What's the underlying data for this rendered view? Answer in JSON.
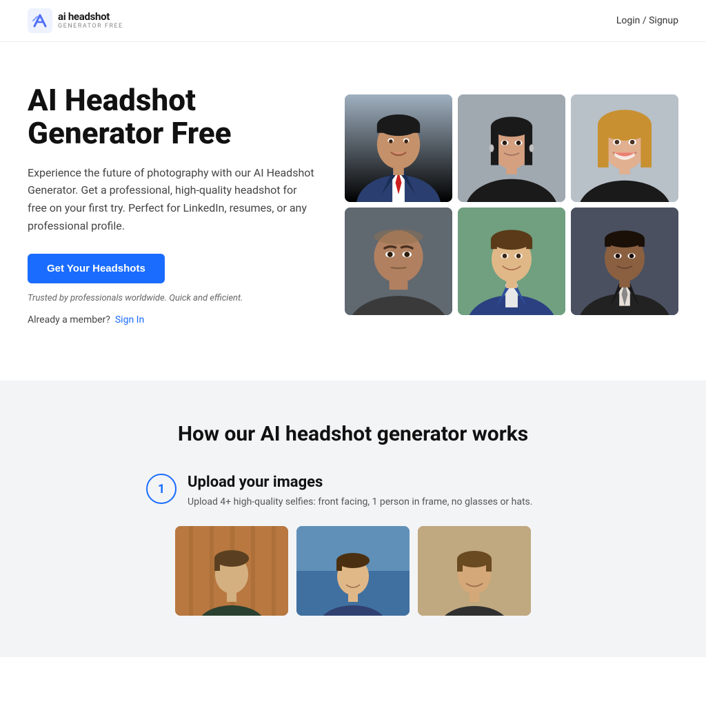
{
  "header": {
    "logo_main": "ai headshot",
    "logo_sub": "GENERATOR FREE",
    "nav_login": "Login / Signup"
  },
  "hero": {
    "title": "AI Headshot Generator Free",
    "description": "Experience the future of photography with our AI Headshot Generator. Get a professional, high-quality headshot for free on your first try. Perfect for LinkedIn, resumes, or any professional profile.",
    "cta_button": "Get Your Headshots",
    "trusted_text": "Trusted by professionals worldwide. Quick and efficient.",
    "member_text": "Already a member?",
    "sign_in_text": "Sign In"
  },
  "photo_grid": {
    "photos": [
      {
        "id": "photo-1",
        "alt": "Professional male headshot in suit"
      },
      {
        "id": "photo-2",
        "alt": "Professional female headshot"
      },
      {
        "id": "photo-3",
        "alt": "Professional female headshot smiling"
      },
      {
        "id": "photo-4",
        "alt": "Bald male professional headshot"
      },
      {
        "id": "photo-5",
        "alt": "Young male professional headshot"
      },
      {
        "id": "photo-6",
        "alt": "Black male professional headshot"
      }
    ]
  },
  "how_section": {
    "title": "How our AI headshot generator works",
    "step1": {
      "number": "1",
      "heading": "Upload your images",
      "description": "Upload 4+ high-quality selfies: front facing, 1 person in frame, no glasses or hats."
    }
  },
  "sample_images": [
    {
      "alt": "Sample selfie 1"
    },
    {
      "alt": "Sample selfie 2"
    },
    {
      "alt": "Sample selfie 3"
    }
  ]
}
